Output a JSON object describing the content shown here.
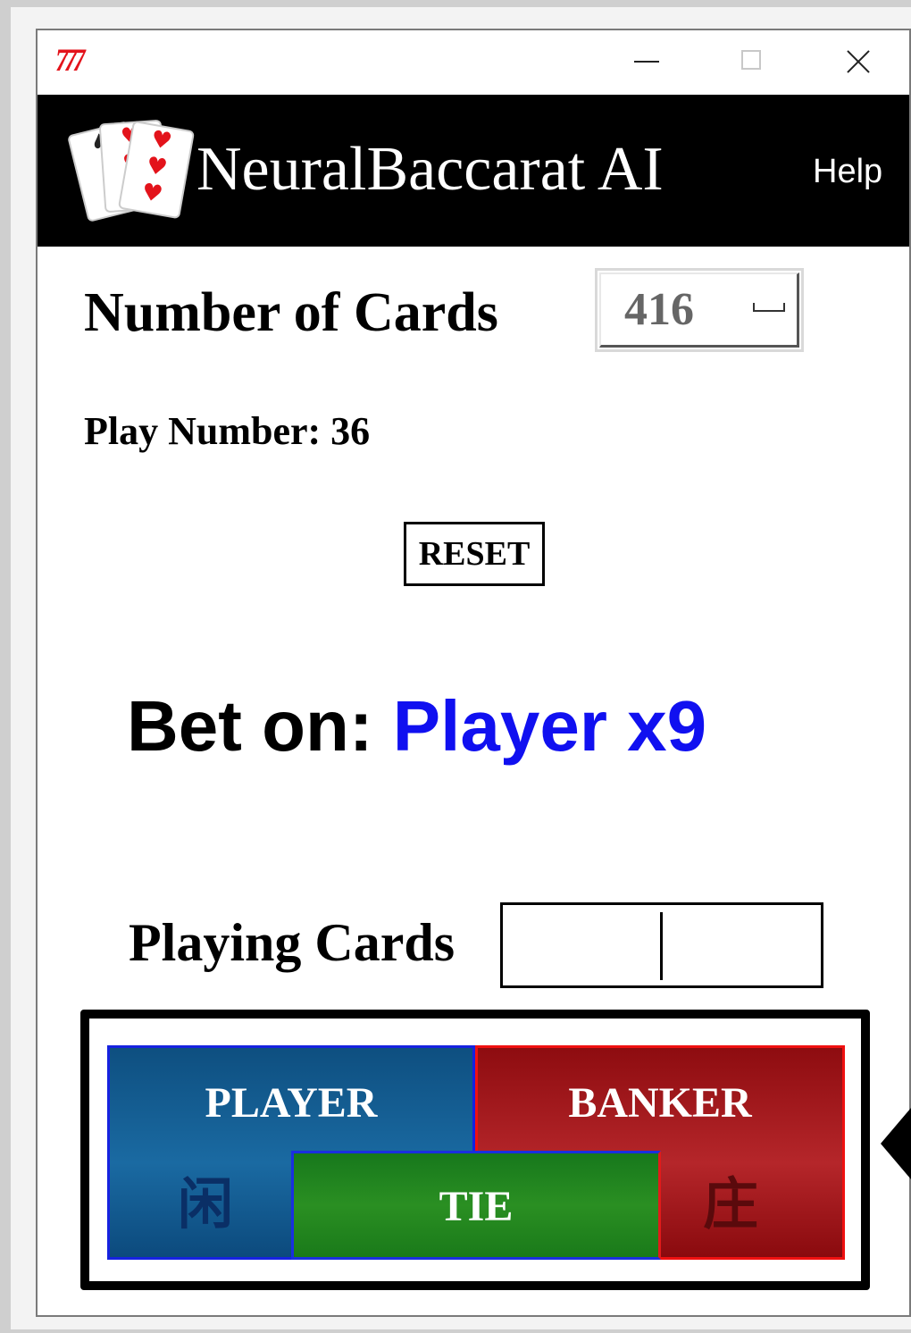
{
  "titlebar": {
    "app_icon_text": "777",
    "minimize_icon": "minimize-icon",
    "maximize_icon": "maximize-icon",
    "close_icon": "close-icon"
  },
  "header": {
    "title": "NeuralBaccarat AI",
    "help_label": "Help",
    "logo_icon": "playing-cards-logo"
  },
  "settings": {
    "num_cards_label": "Number of Cards",
    "num_cards_value": "416"
  },
  "status": {
    "play_number_label": "Play Number: 36"
  },
  "actions": {
    "reset_label": "RESET"
  },
  "prediction": {
    "label": "Bet on:",
    "value": "Player x9",
    "value_color": "#1010f0"
  },
  "cards_input": {
    "label": "Playing Cards",
    "value": ""
  },
  "board": {
    "player": {
      "label": "PLAYER",
      "cn": "闲",
      "color": "#1a6aa2"
    },
    "banker": {
      "label": "BANKER",
      "cn": "庄",
      "color": "#b5262a"
    },
    "tie": {
      "label": "TIE",
      "color": "#2a8f22"
    }
  }
}
